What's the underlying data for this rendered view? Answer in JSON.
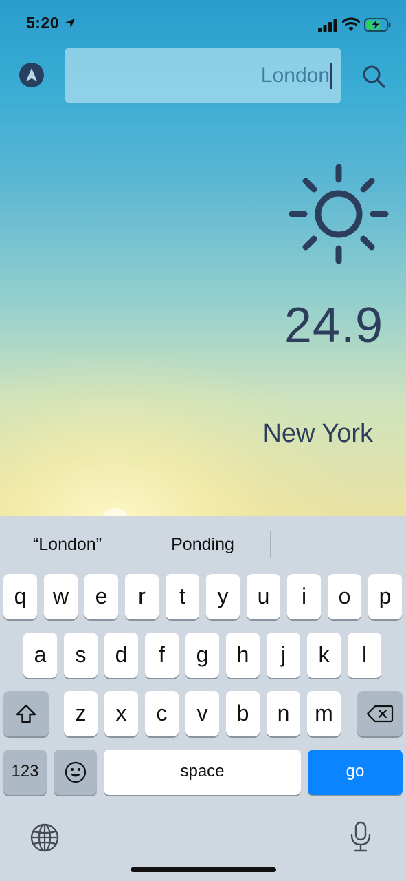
{
  "status_bar": {
    "time": "5:20",
    "icons": [
      "location-arrow-icon",
      "cellular-signal-icon",
      "wifi-icon",
      "battery-charging-icon"
    ]
  },
  "search": {
    "value": "London",
    "nav_icon": "navigation-arrow-icon",
    "search_icon": "search-icon"
  },
  "weather": {
    "icon": "sun-icon",
    "temperature": "24.9",
    "city": "New York"
  },
  "keyboard": {
    "suggestions": [
      "“London”",
      "Ponding",
      ""
    ],
    "row1": [
      "q",
      "w",
      "e",
      "r",
      "t",
      "y",
      "u",
      "i",
      "o",
      "p"
    ],
    "row2": [
      "a",
      "s",
      "d",
      "f",
      "g",
      "h",
      "j",
      "k",
      "l"
    ],
    "row3": [
      "z",
      "x",
      "c",
      "v",
      "b",
      "n",
      "m"
    ],
    "numbers_label": "123",
    "space_label": "space",
    "go_label": "go",
    "extra_icons": [
      "shift-icon",
      "delete-icon",
      "emoji-icon",
      "globe-icon",
      "microphone-icon"
    ]
  },
  "colors": {
    "sky_top": "#2a9ccd",
    "sky_bottom": "#e9e2a3",
    "text_dark": "#2c3e5c",
    "go_key": "#0a84ff"
  }
}
